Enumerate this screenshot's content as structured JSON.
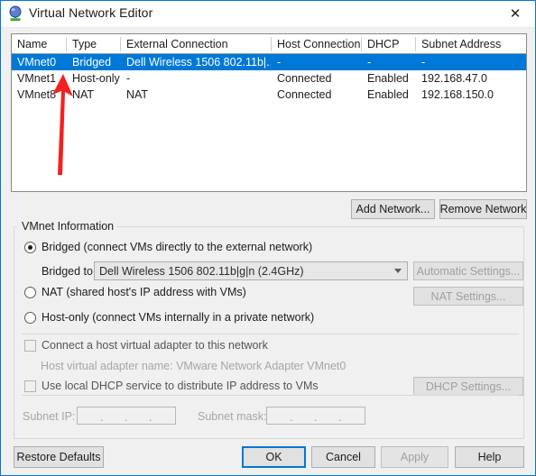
{
  "window": {
    "title": "Virtual Network Editor",
    "icon": "vmware-network-icon",
    "close_label": "✕",
    "border_color": "#0078d7"
  },
  "table": {
    "columns": [
      "Name",
      "Type",
      "External Connection",
      "Host Connection",
      "DHCP",
      "Subnet Address"
    ],
    "rows": [
      {
        "name": "VMnet0",
        "type": "Bridged",
        "external_connection": "Dell Wireless 1506 802.11b|...",
        "host_connection": "-",
        "dhcp": "-",
        "subnet_address": "-",
        "selected": true
      },
      {
        "name": "VMnet1",
        "type": "Host-only",
        "external_connection": "-",
        "host_connection": "Connected",
        "dhcp": "Enabled",
        "subnet_address": "192.168.47.0",
        "selected": false
      },
      {
        "name": "VMnet8",
        "type": "NAT",
        "external_connection": "NAT",
        "host_connection": "Connected",
        "dhcp": "Enabled",
        "subnet_address": "192.168.150.0",
        "selected": false
      }
    ],
    "selection_color": "#0078d7"
  },
  "network_buttons": {
    "add": "Add Network...",
    "remove": "Remove Network"
  },
  "vmnet_info": {
    "group_label": "VMnet Information",
    "bridged": {
      "label": "Bridged (connect VMs directly to the external network)",
      "selected": true
    },
    "bridged_to": {
      "label": "Bridged to:",
      "value": "Dell Wireless 1506 802.11b|g|n (2.4GHz)",
      "arrow_icon": "chevron-down-icon"
    },
    "automatic_settings": {
      "label": "Automatic Settings...",
      "disabled": true
    },
    "nat": {
      "label": "NAT (shared host's IP address with VMs)",
      "selected": false
    },
    "nat_settings": {
      "label": "NAT Settings...",
      "disabled": true
    },
    "host_only": {
      "label": "Host-only (connect VMs internally in a private network)",
      "selected": false
    },
    "connect_host_adapter": {
      "label": "Connect a host virtual adapter to this network",
      "checked": false,
      "disabled": true
    },
    "host_adapter_name": "Host virtual adapter name: VMware Network Adapter VMnet0",
    "local_dhcp": {
      "label": "Use local DHCP service to distribute IP address to VMs",
      "checked": false,
      "disabled": true
    },
    "dhcp_settings": {
      "label": "DHCP Settings...",
      "disabled": true
    },
    "subnet_ip": {
      "label": "Subnet IP:",
      "value": "",
      "separators": [
        ".",
        ".",
        "."
      ]
    },
    "subnet_mask": {
      "label": "Subnet mask:",
      "value": "",
      "separators": [
        ".",
        ".",
        "."
      ]
    }
  },
  "footer": {
    "restore_defaults": "Restore Defaults",
    "ok": "OK",
    "cancel": "Cancel",
    "apply": "Apply",
    "help": "Help",
    "apply_disabled": true,
    "ok_focused": true
  },
  "annotation": {
    "type": "arrow",
    "color": "#f42020",
    "points_to": "VMnet0"
  }
}
